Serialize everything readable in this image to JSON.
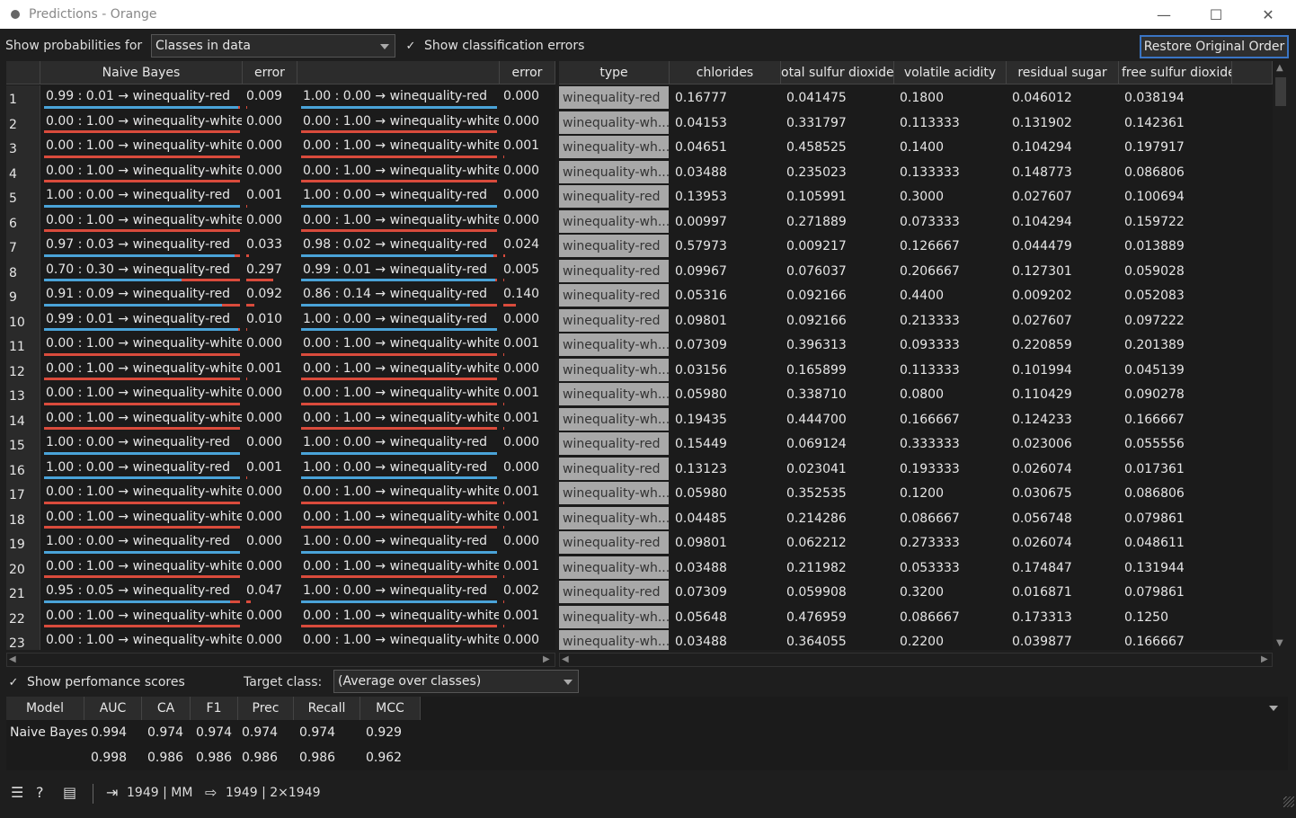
{
  "window": {
    "title": "Predictions - Orange"
  },
  "toolbar": {
    "show_prob_label": "Show probabilities for",
    "show_prob_value": "Classes in data",
    "show_errors_label": "Show classification errors",
    "show_errors_checked": true,
    "restore_label": "Restore Original Order"
  },
  "left_headers": [
    "Naive Bayes",
    "error",
    "",
    "error"
  ],
  "right_headers": [
    "type",
    "chlorides",
    "otal sulfur dioxide",
    "volatile acidity",
    "residual sugar",
    "free sulfur dioxide"
  ],
  "colors": {
    "red_class": "#d94b3c",
    "white_class": "#4aa3d8",
    "type_cell_bg": "#a8a8a8"
  },
  "rows": [
    {
      "n": "1",
      "p1": "0.99 : 0.01 → winequality-red",
      "p1r": 0.99,
      "e1": "0.009",
      "p2": "1.00 : 0.00 → winequality-red",
      "p2r": 1.0,
      "e2": "0.000",
      "type": "winequality-red",
      "chlorides": "0.16777",
      "tsd": "0.041475",
      "va": "0.1800",
      "rs": "0.046012",
      "fsd": "0.038194"
    },
    {
      "n": "2",
      "p1": "0.00 : 1.00 → winequality-white",
      "p1r": 0.0,
      "e1": "0.000",
      "p2": "0.00 : 1.00 → winequality-white",
      "p2r": 0.0,
      "e2": "0.000",
      "type": "winequality-wh...",
      "chlorides": "0.04153",
      "tsd": "0.331797",
      "va": "0.113333",
      "rs": "0.131902",
      "fsd": "0.142361"
    },
    {
      "n": "3",
      "p1": "0.00 : 1.00 → winequality-white",
      "p1r": 0.0,
      "e1": "0.000",
      "p2": "0.00 : 1.00 → winequality-white",
      "p2r": 0.0,
      "e2": "0.001",
      "type": "winequality-wh...",
      "chlorides": "0.04651",
      "tsd": "0.458525",
      "va": "0.1400",
      "rs": "0.104294",
      "fsd": "0.197917"
    },
    {
      "n": "4",
      "p1": "0.00 : 1.00 → winequality-white",
      "p1r": 0.0,
      "e1": "0.000",
      "p2": "0.00 : 1.00 → winequality-white",
      "p2r": 0.0,
      "e2": "0.000",
      "type": "winequality-wh...",
      "chlorides": "0.03488",
      "tsd": "0.235023",
      "va": "0.133333",
      "rs": "0.148773",
      "fsd": "0.086806"
    },
    {
      "n": "5",
      "p1": "1.00 : 0.00 → winequality-red",
      "p1r": 1.0,
      "e1": "0.001",
      "p2": "1.00 : 0.00 → winequality-red",
      "p2r": 1.0,
      "e2": "0.000",
      "type": "winequality-red",
      "chlorides": "0.13953",
      "tsd": "0.105991",
      "va": "0.3000",
      "rs": "0.027607",
      "fsd": "0.100694"
    },
    {
      "n": "6",
      "p1": "0.00 : 1.00 → winequality-white",
      "p1r": 0.0,
      "e1": "0.000",
      "p2": "0.00 : 1.00 → winequality-white",
      "p2r": 0.0,
      "e2": "0.000",
      "type": "winequality-wh...",
      "chlorides": "0.00997",
      "tsd": "0.271889",
      "va": "0.073333",
      "rs": "0.104294",
      "fsd": "0.159722"
    },
    {
      "n": "7",
      "p1": "0.97 : 0.03 → winequality-red",
      "p1r": 0.97,
      "e1": "0.033",
      "p2": "0.98 : 0.02 → winequality-red",
      "p2r": 0.98,
      "e2": "0.024",
      "type": "winequality-red",
      "chlorides": "0.57973",
      "tsd": "0.009217",
      "va": "0.126667",
      "rs": "0.044479",
      "fsd": "0.013889"
    },
    {
      "n": "8",
      "p1": "0.70 : 0.30 → winequality-red",
      "p1r": 0.7,
      "e1": "0.297",
      "p2": "0.99 : 0.01 → winequality-red",
      "p2r": 0.99,
      "e2": "0.005",
      "type": "winequality-red",
      "chlorides": "0.09967",
      "tsd": "0.076037",
      "va": "0.206667",
      "rs": "0.127301",
      "fsd": "0.059028"
    },
    {
      "n": "9",
      "p1": "0.91 : 0.09 → winequality-red",
      "p1r": 0.91,
      "e1": "0.092",
      "p2": "0.86 : 0.14 → winequality-red",
      "p2r": 0.86,
      "e2": "0.140",
      "type": "winequality-red",
      "chlorides": "0.05316",
      "tsd": "0.092166",
      "va": "0.4400",
      "rs": "0.009202",
      "fsd": "0.052083"
    },
    {
      "n": "10",
      "p1": "0.99 : 0.01 → winequality-red",
      "p1r": 0.99,
      "e1": "0.010",
      "p2": "1.00 : 0.00 → winequality-red",
      "p2r": 1.0,
      "e2": "0.000",
      "type": "winequality-red",
      "chlorides": "0.09801",
      "tsd": "0.092166",
      "va": "0.213333",
      "rs": "0.027607",
      "fsd": "0.097222"
    },
    {
      "n": "11",
      "p1": "0.00 : 1.00 → winequality-white",
      "p1r": 0.0,
      "e1": "0.000",
      "p2": "0.00 : 1.00 → winequality-white",
      "p2r": 0.0,
      "e2": "0.001",
      "type": "winequality-wh...",
      "chlorides": "0.07309",
      "tsd": "0.396313",
      "va": "0.093333",
      "rs": "0.220859",
      "fsd": "0.201389"
    },
    {
      "n": "12",
      "p1": "0.00 : 1.00 → winequality-white",
      "p1r": 0.0,
      "e1": "0.001",
      "p2": "0.00 : 1.00 → winequality-white",
      "p2r": 0.0,
      "e2": "0.000",
      "type": "winequality-wh...",
      "chlorides": "0.03156",
      "tsd": "0.165899",
      "va": "0.113333",
      "rs": "0.101994",
      "fsd": "0.045139"
    },
    {
      "n": "13",
      "p1": "0.00 : 1.00 → winequality-white",
      "p1r": 0.0,
      "e1": "0.000",
      "p2": "0.00 : 1.00 → winequality-white",
      "p2r": 0.0,
      "e2": "0.001",
      "type": "winequality-wh...",
      "chlorides": "0.05980",
      "tsd": "0.338710",
      "va": "0.0800",
      "rs": "0.110429",
      "fsd": "0.090278"
    },
    {
      "n": "14",
      "p1": "0.00 : 1.00 → winequality-white",
      "p1r": 0.0,
      "e1": "0.000",
      "p2": "0.00 : 1.00 → winequality-white",
      "p2r": 0.0,
      "e2": "0.001",
      "type": "winequality-wh...",
      "chlorides": "0.19435",
      "tsd": "0.444700",
      "va": "0.166667",
      "rs": "0.124233",
      "fsd": "0.166667"
    },
    {
      "n": "15",
      "p1": "1.00 : 0.00 → winequality-red",
      "p1r": 1.0,
      "e1": "0.000",
      "p2": "1.00 : 0.00 → winequality-red",
      "p2r": 1.0,
      "e2": "0.000",
      "type": "winequality-red",
      "chlorides": "0.15449",
      "tsd": "0.069124",
      "va": "0.333333",
      "rs": "0.023006",
      "fsd": "0.055556"
    },
    {
      "n": "16",
      "p1": "1.00 : 0.00 → winequality-red",
      "p1r": 1.0,
      "e1": "0.001",
      "p2": "1.00 : 0.00 → winequality-red",
      "p2r": 1.0,
      "e2": "0.000",
      "type": "winequality-red",
      "chlorides": "0.13123",
      "tsd": "0.023041",
      "va": "0.193333",
      "rs": "0.026074",
      "fsd": "0.017361"
    },
    {
      "n": "17",
      "p1": "0.00 : 1.00 → winequality-white",
      "p1r": 0.0,
      "e1": "0.000",
      "p2": "0.00 : 1.00 → winequality-white",
      "p2r": 0.0,
      "e2": "0.001",
      "type": "winequality-wh...",
      "chlorides": "0.05980",
      "tsd": "0.352535",
      "va": "0.1200",
      "rs": "0.030675",
      "fsd": "0.086806"
    },
    {
      "n": "18",
      "p1": "0.00 : 1.00 → winequality-white",
      "p1r": 0.0,
      "e1": "0.000",
      "p2": "0.00 : 1.00 → winequality-white",
      "p2r": 0.0,
      "e2": "0.001",
      "type": "winequality-wh...",
      "chlorides": "0.04485",
      "tsd": "0.214286",
      "va": "0.086667",
      "rs": "0.056748",
      "fsd": "0.079861"
    },
    {
      "n": "19",
      "p1": "1.00 : 0.00 → winequality-red",
      "p1r": 1.0,
      "e1": "0.000",
      "p2": "1.00 : 0.00 → winequality-red",
      "p2r": 1.0,
      "e2": "0.000",
      "type": "winequality-red",
      "chlorides": "0.09801",
      "tsd": "0.062212",
      "va": "0.273333",
      "rs": "0.026074",
      "fsd": "0.048611"
    },
    {
      "n": "20",
      "p1": "0.00 : 1.00 → winequality-white",
      "p1r": 0.0,
      "e1": "0.000",
      "p2": "0.00 : 1.00 → winequality-white",
      "p2r": 0.0,
      "e2": "0.001",
      "type": "winequality-wh...",
      "chlorides": "0.03488",
      "tsd": "0.211982",
      "va": "0.053333",
      "rs": "0.174847",
      "fsd": "0.131944"
    },
    {
      "n": "21",
      "p1": "0.95 : 0.05 → winequality-red",
      "p1r": 0.95,
      "e1": "0.047",
      "p2": "1.00 : 0.00 → winequality-red",
      "p2r": 1.0,
      "e2": "0.002",
      "type": "winequality-red",
      "chlorides": "0.07309",
      "tsd": "0.059908",
      "va": "0.3200",
      "rs": "0.016871",
      "fsd": "0.079861"
    },
    {
      "n": "22",
      "p1": "0.00 : 1.00 → winequality-white",
      "p1r": 0.0,
      "e1": "0.000",
      "p2": "0.00 : 1.00 → winequality-white",
      "p2r": 0.0,
      "e2": "0.001",
      "type": "winequality-wh...",
      "chlorides": "0.05648",
      "tsd": "0.476959",
      "va": "0.086667",
      "rs": "0.173313",
      "fsd": "0.1250"
    },
    {
      "n": "23",
      "p1": "0.00 : 1.00 → winequality-white",
      "p1r": 0.0,
      "e1": "0.000",
      "p2": "0.00 : 1.00 → winequality-white",
      "p2r": 0.0,
      "e2": "0.000",
      "type": "winequality-wh...",
      "chlorides": "0.03488",
      "tsd": "0.364055",
      "va": "0.2200",
      "rs": "0.039877",
      "fsd": "0.166667"
    }
  ],
  "scores": {
    "show_label": "Show perfomance scores",
    "show_checked": true,
    "target_label": "Target class:",
    "target_value": "(Average over classes)",
    "headers": [
      "Model",
      "AUC",
      "CA",
      "F1",
      "Prec",
      "Recall",
      "MCC"
    ],
    "rows": [
      [
        "Naive Bayes",
        "0.994",
        "0.974",
        "0.974",
        "0.974",
        "0.974",
        "0.929"
      ],
      [
        "",
        "0.998",
        "0.986",
        "0.986",
        "0.986",
        "0.986",
        "0.962"
      ]
    ]
  },
  "status": {
    "input_text": "1949 | ⅯⅯ",
    "output_text": "1949 | 2×1949"
  }
}
